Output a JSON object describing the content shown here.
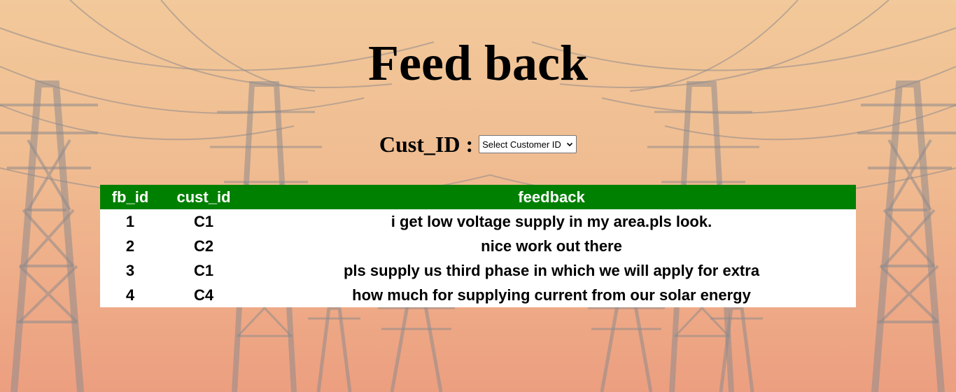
{
  "page": {
    "title": "Feed back"
  },
  "filter": {
    "label": "Cust_ID :",
    "select_value": "Select Customer ID",
    "select_icon": "chevron-down-icon"
  },
  "table": {
    "header_color": "#008000",
    "columns": [
      "fb_id",
      "cust_id",
      "feedback"
    ],
    "rows": [
      {
        "fb_id": "1",
        "cust_id": "C1",
        "feedback": "i get low voltage supply in my area.pls look."
      },
      {
        "fb_id": "2",
        "cust_id": "C2",
        "feedback": "nice work out there"
      },
      {
        "fb_id": "3",
        "cust_id": "C1",
        "feedback": "pls supply us third phase in which we will apply for extra"
      },
      {
        "fb_id": "4",
        "cust_id": "C4",
        "feedback": "how much for supplying current from our solar energy"
      }
    ]
  }
}
